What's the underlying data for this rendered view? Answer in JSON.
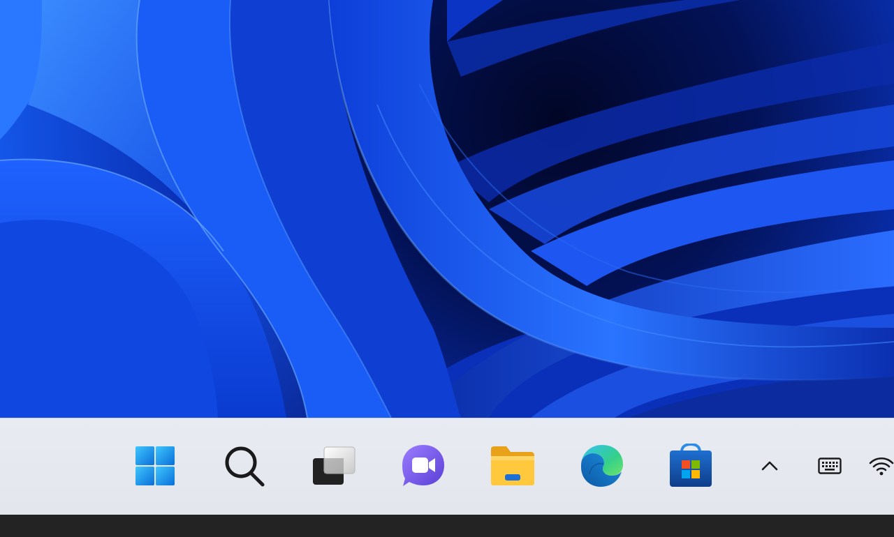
{
  "desktop": {
    "wallpaper": "windows-11-bloom",
    "colors": {
      "deep": "#000a3a",
      "mid": "#0b3cd6",
      "bright": "#2f7bff",
      "light": "#6fb0ff"
    }
  },
  "taskbar": {
    "background": "#e7e9f1",
    "pinned": [
      {
        "name": "start",
        "icon": "windows-logo-icon"
      },
      {
        "name": "search",
        "icon": "search-icon"
      },
      {
        "name": "task-view",
        "icon": "task-view-icon"
      },
      {
        "name": "chat",
        "icon": "chat-video-icon"
      },
      {
        "name": "file-explorer",
        "icon": "folder-icon"
      },
      {
        "name": "edge",
        "icon": "edge-icon"
      },
      {
        "name": "store",
        "icon": "store-icon"
      }
    ],
    "tray": [
      {
        "name": "hidden-icons",
        "icon": "chevron-up-icon"
      },
      {
        "name": "touch-keyboard",
        "icon": "keyboard-icon"
      },
      {
        "name": "network",
        "icon": "wifi-icon"
      }
    ]
  }
}
